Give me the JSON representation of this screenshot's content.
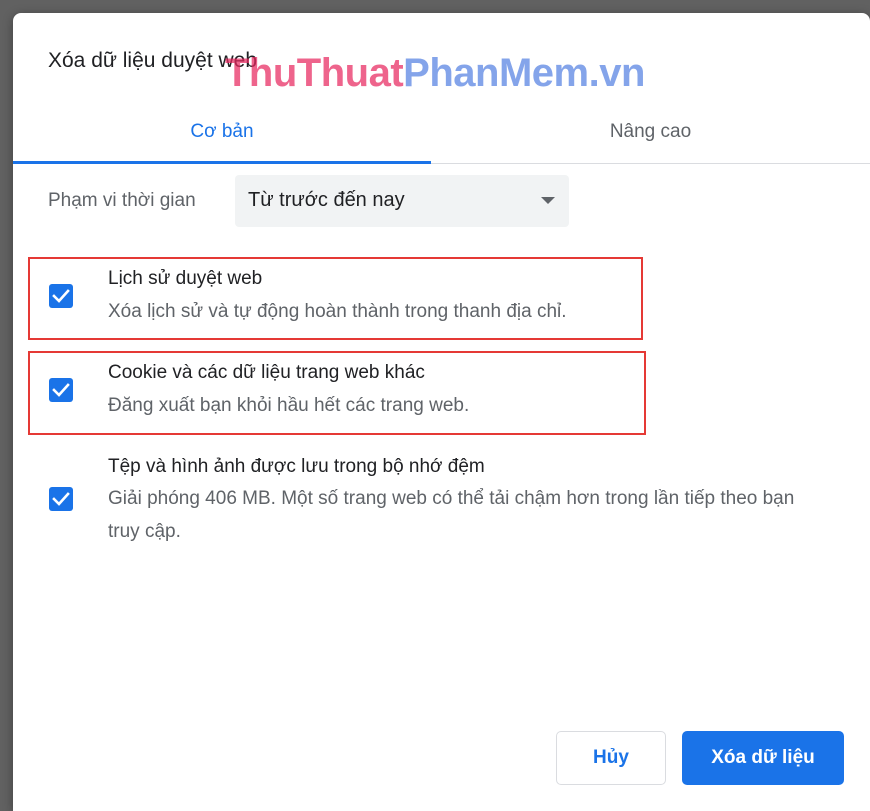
{
  "dialog": {
    "title": "Xóa dữ liệu duyệt web",
    "watermark": {
      "part1": "ThuThuat",
      "part2": "PhanMem.vn"
    }
  },
  "tabs": [
    {
      "label": "Cơ bản",
      "active": true
    },
    {
      "label": "Nâng cao",
      "active": false
    }
  ],
  "time_range": {
    "label": "Phạm vi thời gian",
    "selected": "Từ trước đến nay"
  },
  "options": [
    {
      "title": "Lịch sử duyệt web",
      "description": "Xóa lịch sử và tự động hoàn thành trong thanh địa chỉ.",
      "checked": true,
      "highlighted": true
    },
    {
      "title": "Cookie và các dữ liệu trang web khác",
      "description": "Đăng xuất bạn khỏi hầu hết các trang web.",
      "checked": true,
      "highlighted": true
    },
    {
      "title": "Tệp và hình ảnh được lưu trong bộ nhớ đệm",
      "description": "Giải phóng 406 MB. Một số trang web có thể tải chậm hơn trong lần tiếp theo bạn truy cập.",
      "checked": true,
      "highlighted": false
    }
  ],
  "buttons": {
    "cancel": "Hủy",
    "clear": "Xóa dữ liệu"
  },
  "colors": {
    "accent": "#1a73e8",
    "highlight": "#e53935"
  }
}
